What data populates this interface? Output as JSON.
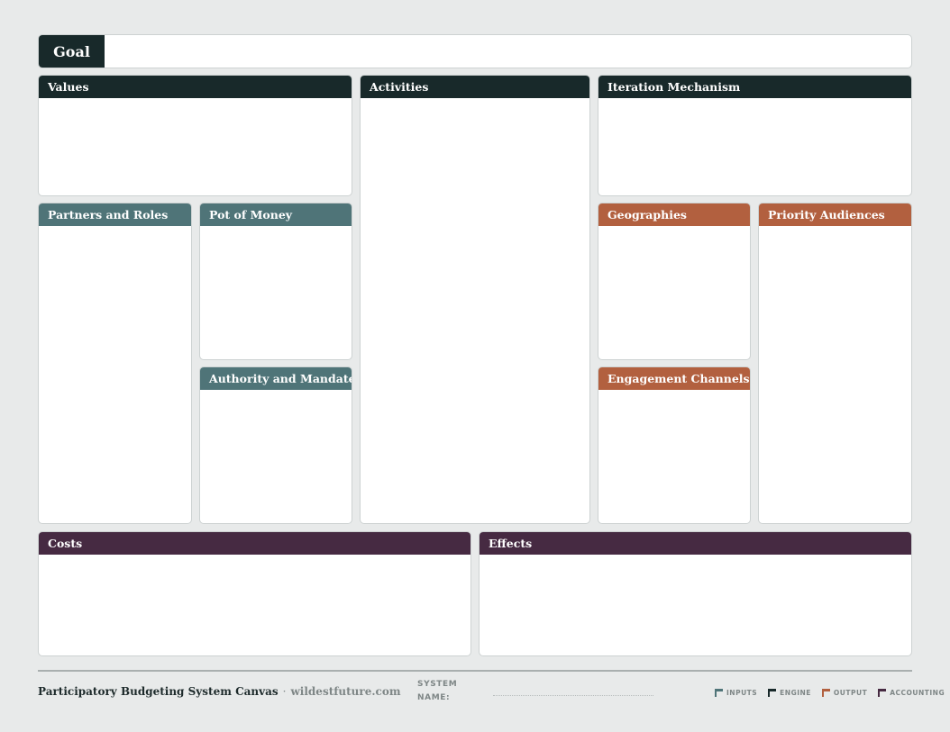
{
  "goal": {
    "label": "Goal",
    "value": ""
  },
  "sections": {
    "values": "Values",
    "activities": "Activities",
    "iteration_mechanism": "Iteration Mechanism",
    "partners_and_roles": "Partners and Roles",
    "pot_of_money": "Pot of Money",
    "authority_and_mandate": "Authority and Mandate",
    "geographies": "Geographies",
    "priority_audiences": "Priority Audiences",
    "engagement_channels": "Engagement Channels",
    "costs": "Costs",
    "effects": "Effects"
  },
  "footer": {
    "title": "Participatory Budgeting System Canvas",
    "separator": "·",
    "site": "wildestfuture.com",
    "system_name_label_line1": "SYSTEM",
    "system_name_label_line2": "NAME:",
    "system_name_value": ""
  },
  "legend": [
    {
      "label": "INPUTS",
      "color": "#4f7478"
    },
    {
      "label": "ENGINE",
      "color": "#18292a"
    },
    {
      "label": "OUTPUT",
      "color": "#b2603f"
    },
    {
      "label": "ACCOUNTING",
      "color": "#462a42"
    }
  ],
  "colors": {
    "engine": "#18292a",
    "inputs": "#4f7478",
    "output": "#b2603f",
    "accounting": "#462a42",
    "background": "#e8eaea"
  }
}
